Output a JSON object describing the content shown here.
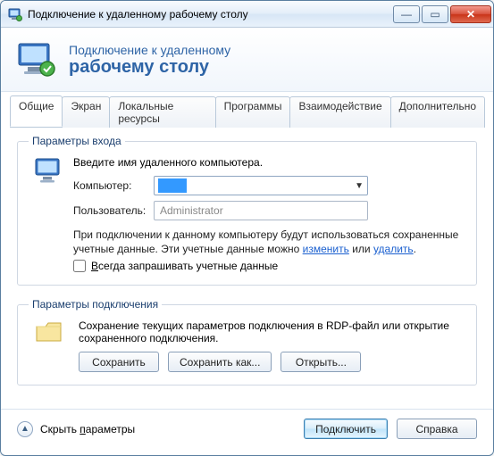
{
  "window": {
    "title": "Подключение к удаленному рабочему столу"
  },
  "header": {
    "line1": "Подключение к удаленному",
    "line2": "рабочему столу"
  },
  "tabs": [
    "Общие",
    "Экран",
    "Локальные ресурсы",
    "Программы",
    "Взаимодействие",
    "Дополнительно"
  ],
  "login": {
    "legend": "Параметры входа",
    "intro": "Введите имя удаленного компьютера.",
    "computer_label": "Компьютер:",
    "computer_value": "",
    "user_label": "Пользователь:",
    "user_value": "Administrator",
    "note_pre": "При подключении к данному компьютеру будут использоваться сохраненные учетные данные. Эти учетные данные можно ",
    "note_edit": "изменить",
    "note_or": " или ",
    "note_delete": "удалить",
    "note_post": ".",
    "always_ask": "Всегда запрашивать учетные данные",
    "always_ask_acc": "В"
  },
  "conn": {
    "legend": "Параметры подключения",
    "text": "Сохранение текущих параметров подключения в RDP-файл или открытие сохраненного подключения.",
    "save": "Сохранить",
    "saveas": "Сохранить как...",
    "open": "Открыть..."
  },
  "footer": {
    "hide": "Скрыть параметры",
    "hide_acc": "п",
    "connect": "Подключить",
    "help": "Справка"
  }
}
